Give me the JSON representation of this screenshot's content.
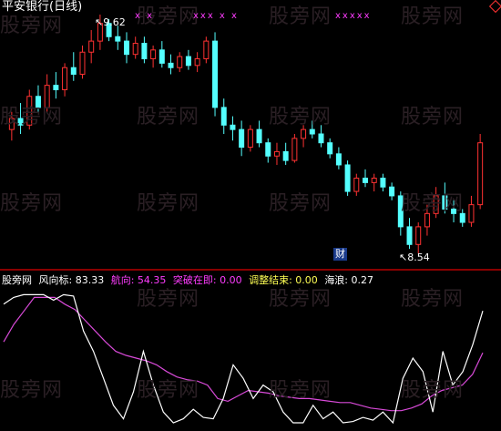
{
  "title": "平安银行(日线)",
  "watermark": "股旁网",
  "top_marks": [
    "xxx x x",
    "x x",
    "xxxxx"
  ],
  "price_high_label": "9.62",
  "price_low_label": "8.54",
  "cai_label": "财",
  "legend": [
    {
      "label": "股旁网",
      "color": "#ffffff"
    },
    {
      "label": "风向标: 83.33",
      "color": "#ffffff"
    },
    {
      "label": "航向: 54.35",
      "color": "#ff3cff"
    },
    {
      "label": "突破在即: 0.00",
      "color": "#ff3cff"
    },
    {
      "label": "调整结束: 0.00",
      "color": "#ffff55"
    },
    {
      "label": "海浪: 0.27",
      "color": "#ffffff"
    }
  ],
  "chart_data": {
    "type": "candlestick+line",
    "candles": [
      [
        9.1,
        9.18,
        9.05,
        9.15
      ],
      [
        9.15,
        9.22,
        9.08,
        9.12
      ],
      [
        9.12,
        9.28,
        9.1,
        9.25
      ],
      [
        9.25,
        9.3,
        9.18,
        9.2
      ],
      [
        9.2,
        9.35,
        9.18,
        9.3
      ],
      [
        9.3,
        9.36,
        9.24,
        9.28
      ],
      [
        9.28,
        9.4,
        9.25,
        9.38
      ],
      [
        9.38,
        9.45,
        9.32,
        9.35
      ],
      [
        9.35,
        9.48,
        9.33,
        9.45
      ],
      [
        9.45,
        9.55,
        9.4,
        9.5
      ],
      [
        9.5,
        9.62,
        9.46,
        9.58
      ],
      [
        9.58,
        9.6,
        9.5,
        9.52
      ],
      [
        9.52,
        9.57,
        9.46,
        9.5
      ],
      [
        9.5,
        9.54,
        9.4,
        9.44
      ],
      [
        9.44,
        9.52,
        9.42,
        9.49
      ],
      [
        9.49,
        9.52,
        9.4,
        9.42
      ],
      [
        9.42,
        9.48,
        9.38,
        9.46
      ],
      [
        9.46,
        9.5,
        9.38,
        9.4
      ],
      [
        9.4,
        9.44,
        9.35,
        9.38
      ],
      [
        9.38,
        9.45,
        9.36,
        9.43
      ],
      [
        9.43,
        9.46,
        9.37,
        9.39
      ],
      [
        9.39,
        9.45,
        9.36,
        9.42
      ],
      [
        9.42,
        9.52,
        9.4,
        9.5
      ],
      [
        9.5,
        9.54,
        9.16,
        9.2
      ],
      [
        9.2,
        9.24,
        9.08,
        9.12
      ],
      [
        9.12,
        9.16,
        9.05,
        9.1
      ],
      [
        9.1,
        9.14,
        8.98,
        9.02
      ],
      [
        9.02,
        9.12,
        9.0,
        9.1
      ],
      [
        9.1,
        9.14,
        9.02,
        9.04
      ],
      [
        9.04,
        9.06,
        8.95,
        8.98
      ],
      [
        8.98,
        9.04,
        8.94,
        9.0
      ],
      [
        9.0,
        9.04,
        8.94,
        8.96
      ],
      [
        8.96,
        9.08,
        8.95,
        9.06
      ],
      [
        9.06,
        9.12,
        9.02,
        9.1
      ],
      [
        9.1,
        9.14,
        9.06,
        9.08
      ],
      [
        9.08,
        9.12,
        9.02,
        9.04
      ],
      [
        9.04,
        9.06,
        8.97,
        8.99
      ],
      [
        8.99,
        9.02,
        8.92,
        8.94
      ],
      [
        8.94,
        8.96,
        8.8,
        8.82
      ],
      [
        8.82,
        8.9,
        8.8,
        8.88
      ],
      [
        8.88,
        8.92,
        8.84,
        8.86
      ],
      [
        8.86,
        8.9,
        8.82,
        8.88
      ],
      [
        8.88,
        8.9,
        8.82,
        8.84
      ],
      [
        8.84,
        8.86,
        8.78,
        8.8
      ],
      [
        8.8,
        8.82,
        8.62,
        8.66
      ],
      [
        8.66,
        8.7,
        8.56,
        8.58
      ],
      [
        8.58,
        8.68,
        8.54,
        8.66
      ],
      [
        8.66,
        8.76,
        8.62,
        8.72
      ],
      [
        8.72,
        8.84,
        8.7,
        8.8
      ],
      [
        8.8,
        8.86,
        8.72,
        8.74
      ],
      [
        8.74,
        8.78,
        8.68,
        8.72
      ],
      [
        8.72,
        8.74,
        8.66,
        8.68
      ],
      [
        8.68,
        8.8,
        8.66,
        8.76
      ],
      [
        8.76,
        9.08,
        8.74,
        9.04
      ]
    ],
    "wind_line": [
      0.62,
      0.75,
      0.85,
      0.95,
      0.95,
      0.95,
      0.9,
      0.86,
      0.78,
      0.7,
      0.62,
      0.55,
      0.52,
      0.5,
      0.48,
      0.45,
      0.4,
      0.36,
      0.34,
      0.33,
      0.3,
      0.2,
      0.18,
      0.22,
      0.26,
      0.25,
      0.24,
      0.22,
      0.21,
      0.2,
      0.2,
      0.19,
      0.18,
      0.17,
      0.17,
      0.15,
      0.13,
      0.12,
      0.11,
      0.11,
      0.13,
      0.16,
      0.22,
      0.26,
      0.28,
      0.3,
      0.38,
      0.54
    ],
    "wave_line": [
      0.9,
      0.95,
      0.97,
      0.97,
      0.97,
      0.93,
      0.97,
      0.96,
      0.7,
      0.55,
      0.35,
      0.15,
      0.05,
      0.25,
      0.55,
      0.3,
      0.1,
      0.02,
      0.05,
      0.12,
      0.06,
      0.05,
      0.2,
      0.45,
      0.35,
      0.2,
      0.3,
      0.25,
      0.1,
      0.02,
      0.02,
      0.15,
      0.05,
      0.1,
      0.02,
      0.03,
      0.06,
      0.04,
      0.1,
      0.02,
      0.35,
      0.5,
      0.4,
      0.1,
      0.55,
      0.3,
      0.4,
      0.6,
      0.85
    ]
  }
}
